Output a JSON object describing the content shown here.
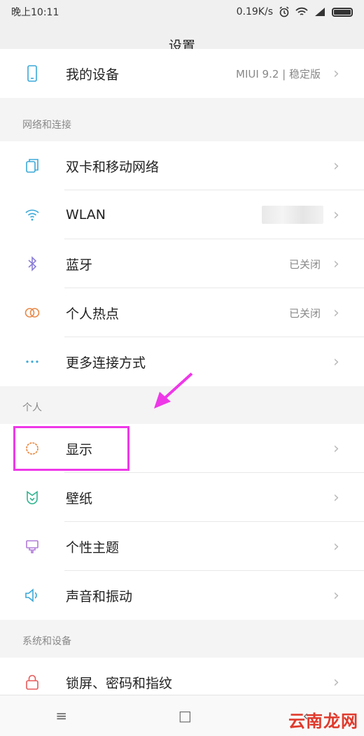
{
  "status_bar": {
    "time": "晚上10:11",
    "net_speed": "0.19K/s"
  },
  "title": "设置",
  "rows": {
    "my_device": {
      "label": "我的设备",
      "value": "MIUI 9.2 | 稳定版"
    },
    "dual_sim": {
      "label": "双卡和移动网络"
    },
    "wlan": {
      "label": "WLAN"
    },
    "bluetooth": {
      "label": "蓝牙",
      "value": "已关闭"
    },
    "hotspot": {
      "label": "个人热点",
      "value": "已关闭"
    },
    "more_conn": {
      "label": "更多连接方式"
    },
    "display": {
      "label": "显示"
    },
    "wallpaper": {
      "label": "壁纸"
    },
    "theme": {
      "label": "个性主题"
    },
    "sound": {
      "label": "声音和振动"
    },
    "lockscreen": {
      "label": "锁屏、密码和指纹"
    }
  },
  "sections": {
    "network": "网络和连接",
    "personal": "个人",
    "system": "系统和设备"
  },
  "chevron": "›",
  "nav": {
    "menu": "≡",
    "home": "□",
    "back": "‹"
  },
  "watermark": "云南龙网",
  "colors": {
    "accent_blue": "#3aa8d8",
    "bluetooth_purple": "#8a7dd8",
    "hotspot_orange": "#e88a4a",
    "display_orange": "#e8833a",
    "wallpaper_green": "#2fb38e",
    "theme_purple": "#b07bd8",
    "lock_red": "#e85a5a",
    "highlight_magenta": "#ee38e8"
  }
}
